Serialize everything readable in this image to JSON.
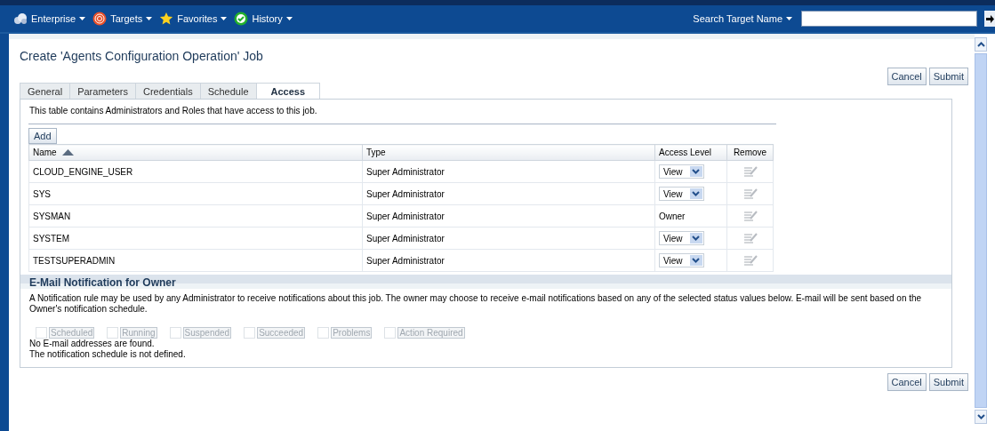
{
  "global_nav": {
    "menus": [
      {
        "label": "Enterprise",
        "kind": "cloud"
      },
      {
        "label": "Targets",
        "kind": "target"
      },
      {
        "label": "Favorites",
        "kind": "star"
      },
      {
        "label": "History",
        "kind": "check"
      }
    ],
    "search_label": "Search Target Name"
  },
  "page": {
    "title": "Create 'Agents Configuration Operation' Job",
    "top_buttons": [
      "Cancel",
      "Submit"
    ],
    "bottom_buttons": [
      "Cancel",
      "Submit"
    ]
  },
  "tabs": [
    {
      "label": "General",
      "selected": false
    },
    {
      "label": "Parameters",
      "selected": false
    },
    {
      "label": "Credentials",
      "selected": false
    },
    {
      "label": "Schedule",
      "selected": false
    },
    {
      "label": "Access",
      "selected": true
    }
  ],
  "access": {
    "description": "This table contains Administrators and Roles that have access to this job.",
    "add_button": "Add",
    "columns": [
      "Name",
      "Type",
      "Access Level",
      "Remove"
    ],
    "rows": [
      {
        "name": "CLOUD_ENGINE_USER",
        "type": "Super Administrator",
        "access_level": {
          "kind": "select",
          "value": "View"
        }
      },
      {
        "name": "SYS",
        "type": "Super Administrator",
        "access_level": {
          "kind": "select",
          "value": "View"
        }
      },
      {
        "name": "SYSMAN",
        "type": "Super Administrator",
        "access_level": {
          "kind": "text",
          "value": "Owner"
        }
      },
      {
        "name": "SYSTEM",
        "type": "Super Administrator",
        "access_level": {
          "kind": "select",
          "value": "View"
        }
      },
      {
        "name": "TESTSUPERADMIN",
        "type": "Super Administrator",
        "access_level": {
          "kind": "select",
          "value": "View"
        }
      }
    ]
  },
  "notification": {
    "heading": "E-Mail Notification for Owner",
    "description": "A Notification rule may be used by any Administrator to receive notifications about this job. The owner may choose to receive e-mail notifications based on any of the selected status values below. E-mail will be sent based on the Owner's notification schedule.",
    "statuses": [
      {
        "label": "Scheduled",
        "checked": false,
        "disabled": true
      },
      {
        "label": "Running",
        "checked": false,
        "disabled": true
      },
      {
        "label": "Suspended",
        "checked": false,
        "disabled": true
      },
      {
        "label": "Succeeded",
        "checked": false,
        "disabled": true
      },
      {
        "label": "Problems",
        "checked": false,
        "disabled": true
      },
      {
        "label": "Action Required",
        "checked": false,
        "disabled": true
      }
    ],
    "messages": [
      "No E-mail addresses are found.",
      "The notification schedule is not defined."
    ]
  }
}
